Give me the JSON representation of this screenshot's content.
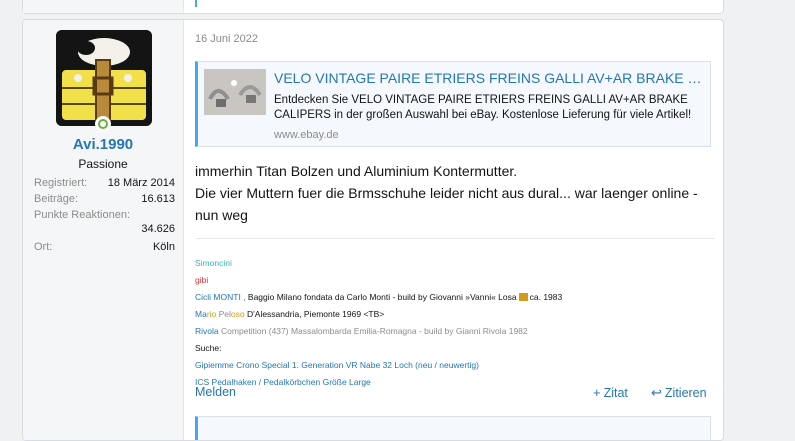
{
  "post": {
    "date": "16 Juni 2022",
    "user": {
      "name": "Avi.1990",
      "title": "Passione",
      "stats": [
        {
          "label": "Registriert:",
          "value": "18 März 2014"
        },
        {
          "label": "Beiträge:",
          "value": "16.613"
        },
        {
          "label": "Punkte Reaktionen:",
          "value": "34.626"
        },
        {
          "label": "Ort:",
          "value": "Köln"
        }
      ]
    },
    "embed": {
      "title": "VELO VINTAGE PAIRE ETRIERS FREINS GALLI AV+AR BRAKE CALIPERS | eBay",
      "description": "Entdecken Sie VELO VINTAGE PAIRE ETRIERS FREINS GALLI AV+AR BRAKE CALIPERS in der großen Auswahl bei eBay. Kostenlose Lieferung für viele Artikel!",
      "domain": "www.ebay.de"
    },
    "body": {
      "line1": "immerhin Titan Bolzen und Aluminium Kontermutter.",
      "line2": "Die vier Muttern fuer die Brmsschuhe leider nicht aus dural... war laenger online - nun weg"
    },
    "signature": {
      "simoncini": "Simoncini",
      "gibi": "gibi",
      "cicli_monti": "Cicli MONTI ,",
      "cicli_monti_text": "Baggio Milano fondata da Carlo Monti - build by Giovanni »Vanni« Losa",
      "cicli_monti_year": "ca. 1983",
      "mario_a": "Ma",
      "mario_b": "rio",
      "mario_c": " Pel",
      "mario_d": "oso",
      "mario_text": "D'Alessandria, Piemonte 1969 <TB>",
      "rivola": "Rivola",
      "rivola_competition": "Competition",
      "rivola_text": "(437) Massalombarda Emilia-Romagna - build by Gianni Rivola 1982",
      "suche": "Suche:",
      "link1": "Gipiemme Crono Special 1. Generation VR Nabe 32 Loch (neu / neuwertig)",
      "link2": "ICS Pedalhaken / Pedalkörbchen Größe Large"
    },
    "actions": {
      "report": "Melden",
      "quote": "Zitat",
      "reply": "Zitieren"
    }
  },
  "colors": {
    "link": "#2577b1",
    "accent": "#47a7eb",
    "online": "#63b33a"
  }
}
